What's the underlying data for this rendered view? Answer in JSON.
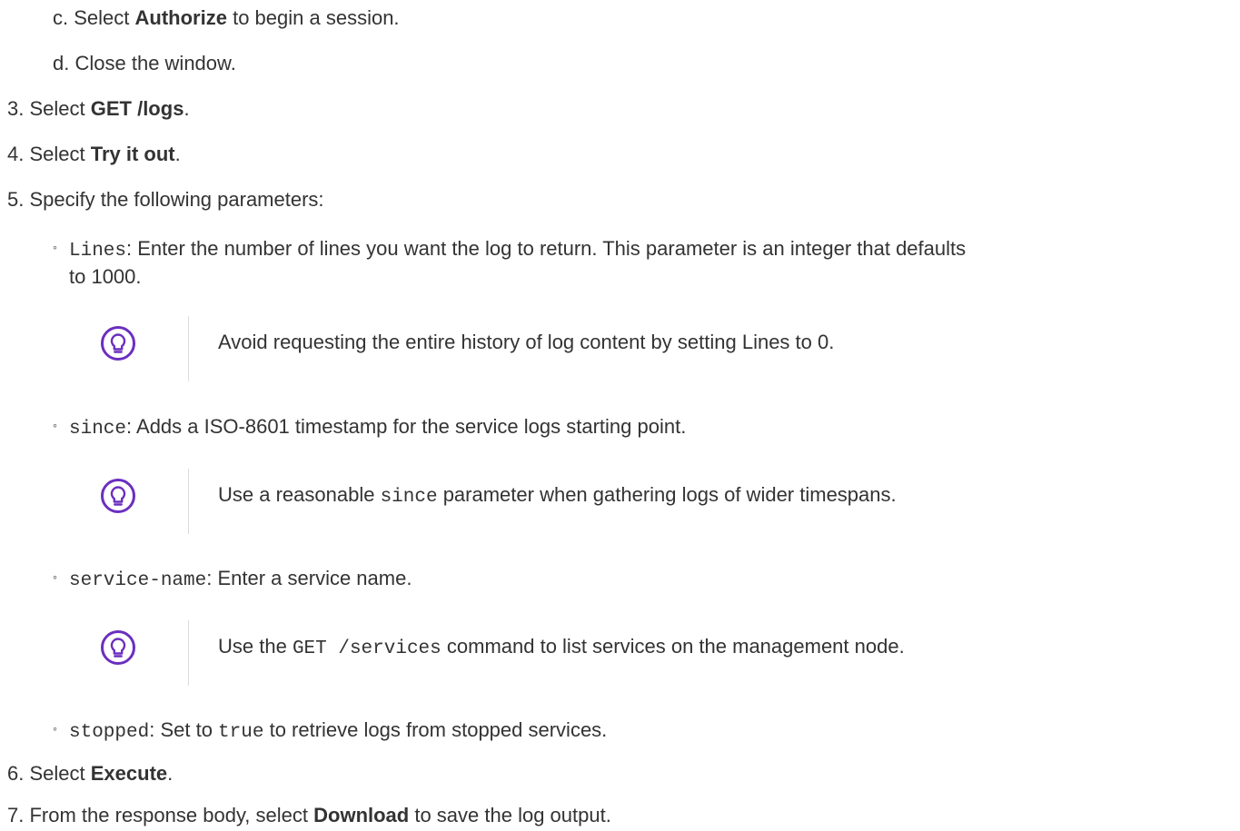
{
  "steps": {
    "c": {
      "marker": "c.",
      "pre": "Select ",
      "bold": "Authorize",
      "post": " to begin a session."
    },
    "d": {
      "marker": "d.",
      "text": "Close the window."
    },
    "s3": {
      "marker": "3.",
      "pre": "Select ",
      "bold": "GET /logs",
      "post": "."
    },
    "s4": {
      "marker": "4.",
      "pre": "Select ",
      "bold": "Try it out",
      "post": "."
    },
    "s5": {
      "marker": "5.",
      "text": "Specify the following parameters:"
    },
    "s6": {
      "marker": "6.",
      "pre": "Select ",
      "bold": "Execute",
      "post": "."
    },
    "s7": {
      "marker": "7.",
      "pre": "From the response body, select ",
      "bold": "Download",
      "post": " to save the log output."
    }
  },
  "params": {
    "lines": {
      "bullet": "◦",
      "code": "Lines",
      "text": ": Enter the number of lines you want the log to return. This parameter is an integer that defaults",
      "text2": "to 1000."
    },
    "since": {
      "bullet": "◦",
      "code": "since",
      "text": ": Adds a ISO-8601 timestamp for the service logs starting point."
    },
    "service": {
      "bullet": "◦",
      "code": "service-name",
      "text": ": Enter a service name."
    },
    "stopped": {
      "bullet": "◦",
      "code": "stopped",
      "pre": ": Set to ",
      "code2": "true",
      "post": " to retrieve logs from stopped services."
    }
  },
  "tips": {
    "tip1": {
      "icon": "lightbulb-icon",
      "text": "Avoid requesting the entire history of log content by setting Lines to 0."
    },
    "tip2": {
      "icon": "lightbulb-icon",
      "pre": "Use a reasonable ",
      "code": "since",
      "post": " parameter when gathering logs of wider timespans."
    },
    "tip3": {
      "icon": "lightbulb-icon",
      "pre": "Use the ",
      "code": "GET /services",
      "post": " command to list services on the management node."
    }
  },
  "colors": {
    "tip_icon": "#6b2fbf",
    "text": "#333333"
  }
}
